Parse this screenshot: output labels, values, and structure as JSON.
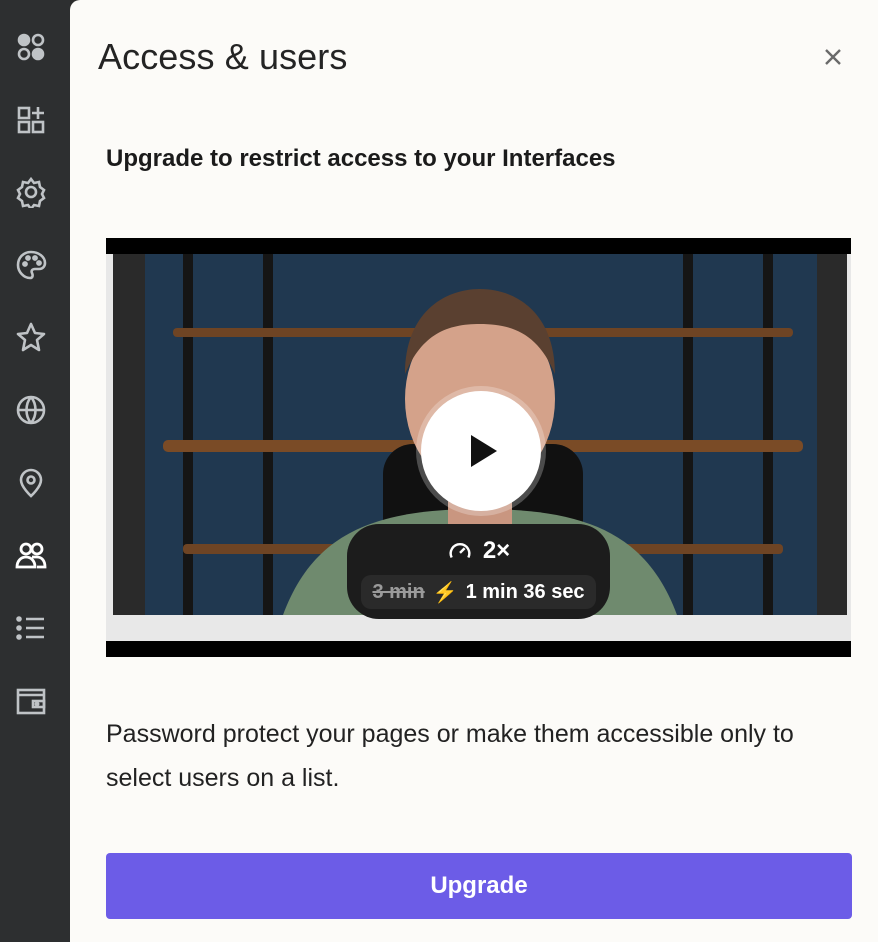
{
  "sidebar": {
    "icons": [
      {
        "name": "apps-icon"
      },
      {
        "name": "add-widget-icon"
      },
      {
        "name": "settings-gear-icon"
      },
      {
        "name": "palette-icon"
      },
      {
        "name": "star-icon"
      },
      {
        "name": "globe-icon"
      },
      {
        "name": "location-pin-icon"
      },
      {
        "name": "users-icon",
        "active": true
      },
      {
        "name": "list-icon"
      },
      {
        "name": "wallet-icon"
      }
    ]
  },
  "panel": {
    "title": "Access & users",
    "close_icon": "close-icon",
    "headline": "Upgrade to restrict access to your Interfaces",
    "video": {
      "speed_label": "2×",
      "old_duration": "3 min",
      "new_duration": "1 min 36 sec"
    },
    "description": "Password protect your pages or make them accessible only to select users on a list.",
    "upgrade_label": "Upgrade"
  },
  "colors": {
    "sidebar_bg": "#2d2f30",
    "panel_bg": "#fcfbf8",
    "accent": "#6c5ce7",
    "bolt": "#f4b400"
  }
}
